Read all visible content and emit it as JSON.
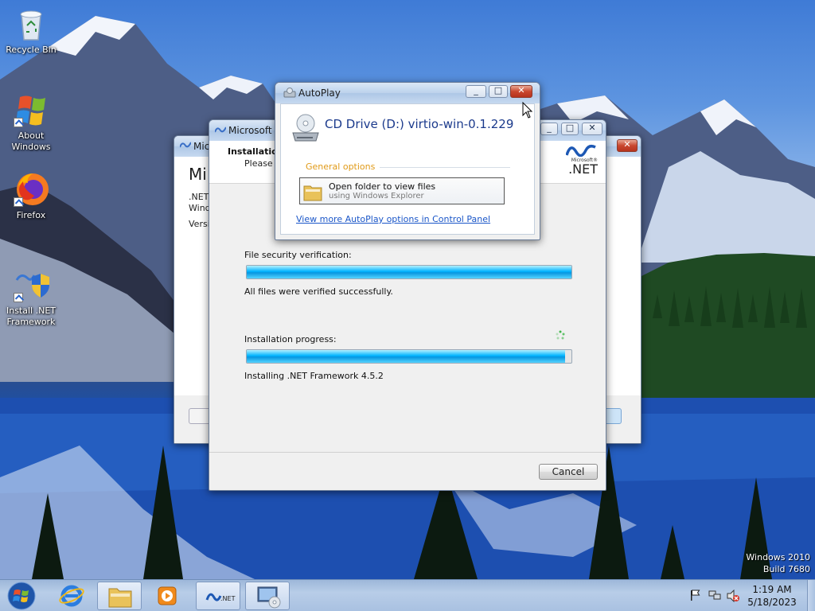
{
  "desktop": {
    "icons": [
      {
        "label": "Recycle Bin",
        "icon": "recycle-bin-icon"
      },
      {
        "label": "About Windows",
        "icon": "windows-logo-icon"
      },
      {
        "label": "Firefox",
        "icon": "firefox-icon"
      },
      {
        "label": "Install .NET Framework",
        "icon": "dotnet-shield-icon"
      }
    ],
    "watermark": {
      "line1": "Windows 2010",
      "line2": "Build 7680"
    }
  },
  "back_window": {
    "title": "Mic",
    "heading": "Mi",
    "lines": [
      ".NET",
      "Wind",
      "Versi"
    ]
  },
  "installer": {
    "title": "Microsoft .I",
    "header_title": "Installatio",
    "header_sub": "Please w",
    "logo_small": "Microsoft®",
    "logo_big": ".NET",
    "security_label": "File security verification:",
    "security_progress": 100,
    "security_status": "All files were verified successfully.",
    "install_label": "Installation progress:",
    "install_progress": 98,
    "install_status": "Installing .NET Framework 4.5.2",
    "cancel_label": "Cancel"
  },
  "autoplay": {
    "title": "AutoPlay",
    "drive_title": "CD Drive (D:) virtio-win-0.1.229",
    "section": "General options",
    "option_title": "Open folder to view files",
    "option_sub": "using Windows Explorer",
    "link": "View more AutoPlay options in Control Panel"
  },
  "taskbar": {
    "items": [
      "start-orb",
      "internet-explorer",
      "windows-explorer",
      "media-player",
      "dotnet-installer",
      "autoplay-drive"
    ],
    "clock_time": "1:19 AM",
    "clock_date": "5/18/2023"
  },
  "colors": {
    "accent": "#0796e0",
    "link": "#1a56c8",
    "section": "#e09a18"
  }
}
